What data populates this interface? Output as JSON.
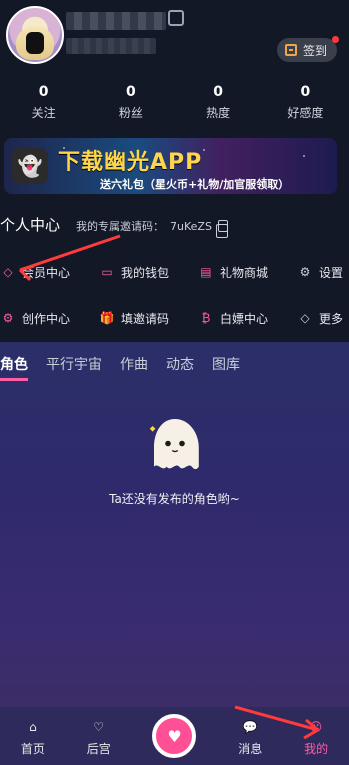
{
  "header": {
    "checkin_label": "签到"
  },
  "stats": [
    {
      "value": "0",
      "label": "关注"
    },
    {
      "value": "0",
      "label": "粉丝"
    },
    {
      "value": "0",
      "label": "热度"
    },
    {
      "value": "0",
      "label": "好感度"
    }
  ],
  "banner": {
    "title": "下载幽光APP",
    "subtitle": "送六礼包（星火币+礼物/加官服领取）"
  },
  "personal_center": {
    "title": "个人中心",
    "invite_prefix": "我的专属邀请码：",
    "invite_code": "7uKeZS"
  },
  "menu": {
    "row1": [
      "会员中心",
      "我的钱包",
      "礼物商城",
      "设置"
    ],
    "row2": [
      "创作中心",
      "填邀请码",
      "白嫖中心",
      "更多"
    ]
  },
  "tabs": [
    "角色",
    "平行宇宙",
    "作曲",
    "动态",
    "图库"
  ],
  "empty_text": "Ta还没有发布的角色哟~",
  "bottom_nav": {
    "items": [
      "首页",
      "后宫",
      "",
      "消息",
      "我的"
    ]
  },
  "colors": {
    "accent": "#ff5da6",
    "bg_dark": "#131827",
    "content_bg": "#2b2f69"
  }
}
